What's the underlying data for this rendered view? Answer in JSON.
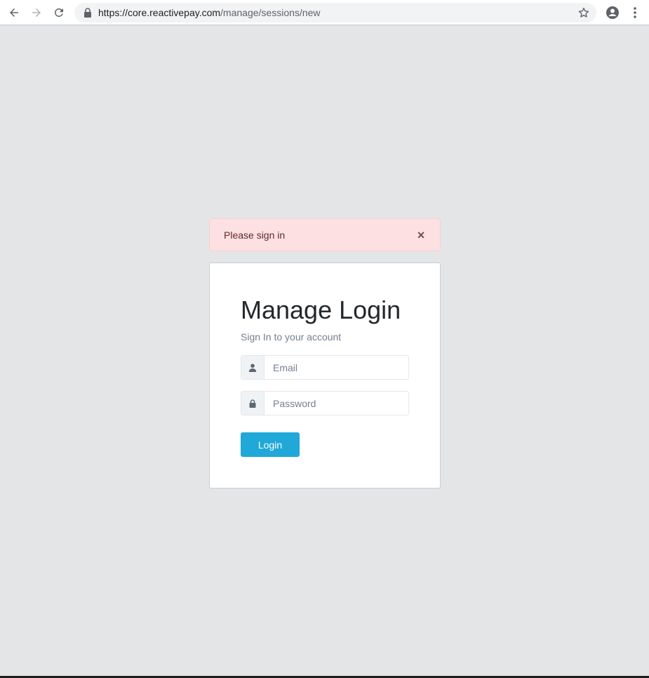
{
  "browser": {
    "url_host": "https://core.reactivepay.com",
    "url_path": "/manage/sessions/new"
  },
  "alert": {
    "message": "Please sign in",
    "close_label": "×"
  },
  "login": {
    "title": "Manage Login",
    "subtitle": "Sign In to your account",
    "email_placeholder": "Email",
    "password_placeholder": "Password",
    "button_label": "Login"
  },
  "colors": {
    "background": "#e4e5e6",
    "alert_bg": "#fde0e1",
    "primary": "#20a8d8",
    "text_dark": "#23282c",
    "text_muted": "#73818f"
  }
}
